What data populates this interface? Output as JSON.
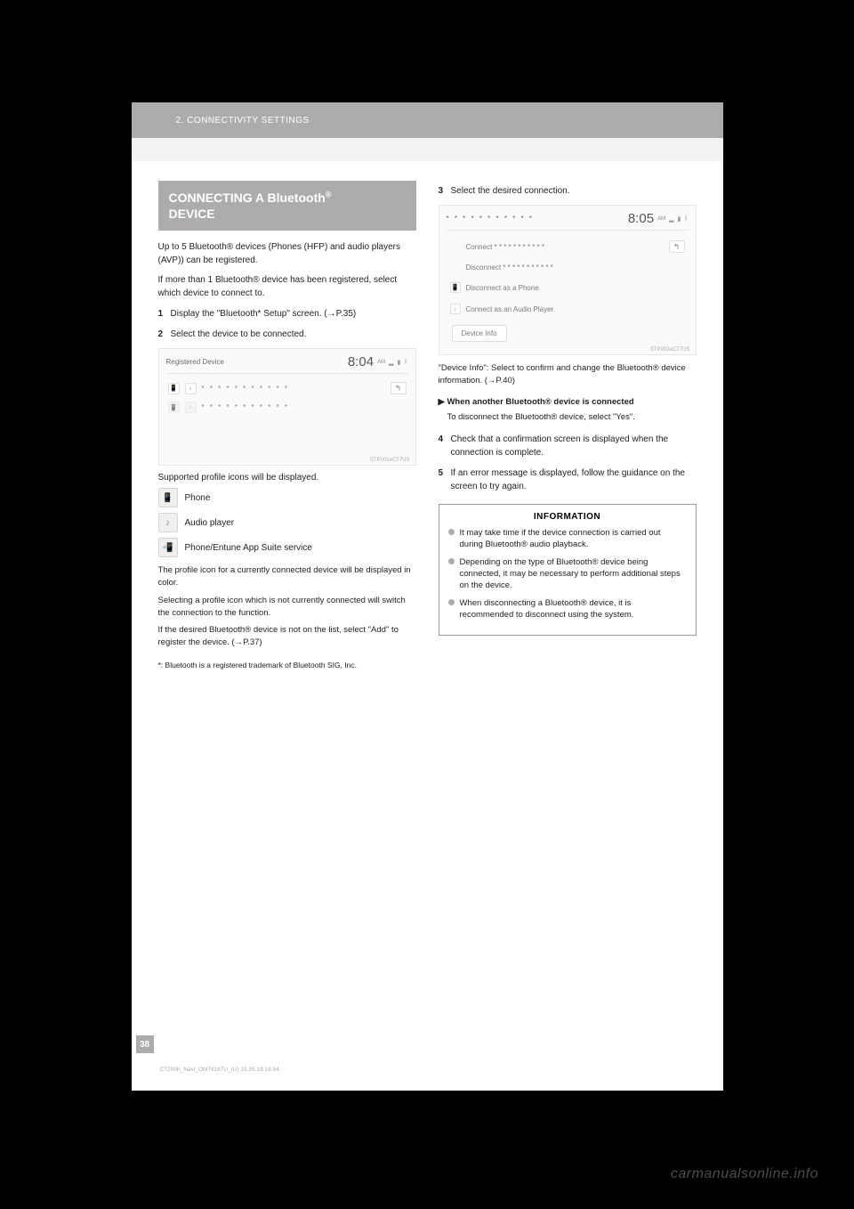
{
  "header": {
    "breadcrumb": "2. CONNECTIVITY SETTINGS"
  },
  "left": {
    "title_line": "CONNECTING A Bluetooth",
    "title_line2": "DEVICE",
    "sup": "®",
    "intro1": "Up to 5 Bluetooth® devices (Phones (HFP) and audio players (AVP)) can be registered.",
    "intro2": "If more than 1 Bluetooth® device has been registered, select which device to connect to.",
    "step1num": "1",
    "step1": "Display the \"Bluetooth* Setup\" screen.",
    "step1ref": "(→P.35)",
    "step2num": "2",
    "step2": "Select the device to be connected.",
    "below_ss": "Supported profile icons will be displayed.",
    "icons": [
      {
        "glyph": "📱",
        "label": "Phone"
      },
      {
        "glyph": "♪",
        "label": "Audio player"
      },
      {
        "glyph": "📲",
        "label": "Phone/Entune App Suite service"
      }
    ],
    "notes": [
      "The profile icon for a currently connected device will be displayed in color.",
      "Selecting a profile icon which is not currently connected will switch the connection to the function.",
      "If the desired Bluetooth® device is not on the list, select \"Add\" to register the device. (→P.37)"
    ],
    "footnote": "*: Bluetooth is a registered trademark of Bluetooth SIG, Inc."
  },
  "right": {
    "step3num": "3",
    "step3": "Select the desired connection.",
    "substeps": [
      "\"Device Info\": Select to confirm and change the Bluetooth® device information. (→P.40)",
      "When another Bluetooth® device is connected",
      "To disconnect the Bluetooth® device, select \"Yes\".",
      "Check that a confirmation screen is displayed when the connection is complete.",
      "If an error message is displayed, follow the guidance on the screen to try again."
    ],
    "step4num": "4",
    "step5num": "5",
    "info_title": "INFORMATION",
    "bullets": [
      "It may take time if the device connection is carried out during Bluetooth® audio playback.",
      "Depending on the type of Bluetooth® device being connected, it may be necessary to perform additional steps on the device.",
      "When disconnecting a Bluetooth® device, it is recommended to disconnect using the system."
    ]
  },
  "ss1": {
    "title": "Registered Device",
    "time": "8:04",
    "ampm": "AM",
    "row1": "* * * * * * * * * * *",
    "row2": "* * * * * * * * * * *",
    "caption": "STP001eCT7US"
  },
  "ss2": {
    "title": "* * * * * * * * * * *",
    "time": "8:05",
    "ampm": "AM",
    "rows": [
      {
        "icon": "",
        "label": "Connect * * * * * * * * * * *"
      },
      {
        "icon": "",
        "label": "Disconnect * * * * * * * * * * *"
      },
      {
        "icon": "📱",
        "label": "Disconnect as a Phone"
      },
      {
        "icon": "♪",
        "label": "Connect as an Audio Player"
      }
    ],
    "btn": "Device Info",
    "caption": "STP002eCT7US"
  },
  "page_number": "38",
  "footer_text": "CT200h_Navi_OM76187U_(U)    15.05.18    16:54",
  "watermark": "carmanualsonline.info"
}
